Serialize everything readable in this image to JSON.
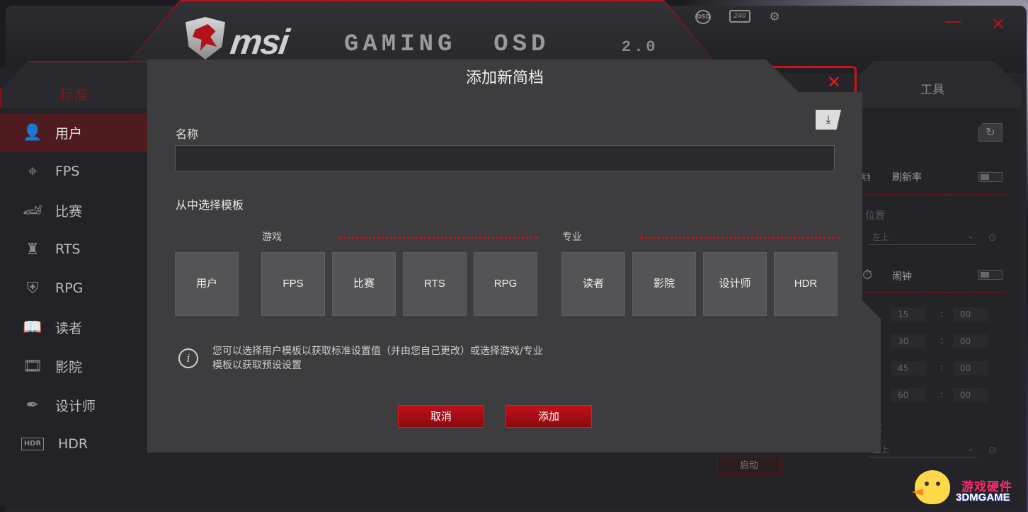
{
  "app": {
    "header_icons": {
      "osd": "OSD",
      "refresh_rate": "240"
    },
    "sidebar": {
      "tab_label": "标准",
      "items": [
        {
          "label": "用户",
          "icon": "user-icon",
          "glyph": "👤"
        },
        {
          "label": "FPS",
          "icon": "crosshair-icon",
          "glyph": "⌖"
        },
        {
          "label": "比赛",
          "icon": "race-car-icon",
          "glyph": "🏎"
        },
        {
          "label": "RTS",
          "icon": "chess-rook-icon",
          "glyph": "♜"
        },
        {
          "label": "RPG",
          "icon": "helmet-icon",
          "glyph": "⛨"
        },
        {
          "label": "读者",
          "icon": "book-icon",
          "glyph": "📖"
        },
        {
          "label": "影院",
          "icon": "film-icon",
          "glyph": "🎞"
        },
        {
          "label": "设计师",
          "icon": "pen-icon",
          "glyph": "✒"
        },
        {
          "label": "HDR",
          "icon": "hdr-icon",
          "glyph": "HDR"
        }
      ]
    },
    "right_panel": {
      "tab_label": "工具",
      "refresh_rate_label": "刷新率",
      "position_label": "位置",
      "position_value": "左上",
      "alarm_label": "闹钟",
      "alarm_rows": [
        {
          "min": "15",
          "sec": "00"
        },
        {
          "min": "30",
          "sec": "00"
        },
        {
          "min": "45",
          "sec": "00"
        },
        {
          "min": "60",
          "sec": "00"
        }
      ],
      "position2_label": "置",
      "position2_value": "左上",
      "start_label": "启动"
    }
  },
  "modal": {
    "title": "添加新简档",
    "name_label": "名称",
    "name_value": "",
    "template_label": "从中选择模板",
    "game_group_label": "游戏",
    "pro_group_label": "专业",
    "user_template": "用户",
    "game_templates": [
      "FPS",
      "比赛",
      "RTS",
      "RPG"
    ],
    "pro_templates": [
      "读者",
      "影院",
      "设计师",
      "HDR"
    ],
    "info_text_line1": "您可以选择用户模板以获取标准设置值（并由您自己更改）或选择游戏/专业",
    "info_text_line2": "模板以获取预设设置",
    "cancel_label": "取消",
    "add_label": "添加"
  },
  "watermark": {
    "line1": "游戏硬件",
    "line2": "3DMGAME"
  },
  "colors": {
    "accent_red": "#c0101a",
    "modal_bg": "#3d3d40",
    "tile_bg": "#545457"
  }
}
